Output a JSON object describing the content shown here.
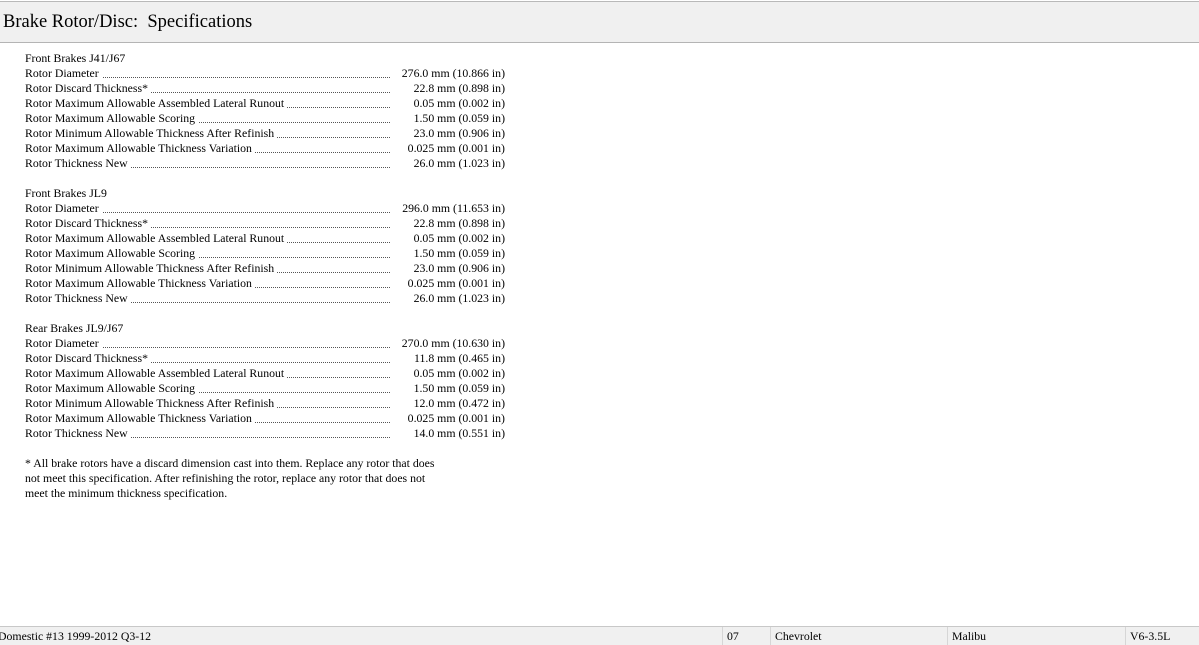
{
  "header": {
    "title": "Brake Rotor/Disc:  Specifications"
  },
  "sections": [
    {
      "heading": "Front Brakes J41/J67",
      "rows": [
        {
          "label": "Rotor Diameter",
          "value": "276.0 mm (10.866 in)"
        },
        {
          "label": "Rotor Discard Thickness*",
          "value": "22.8 mm (0.898 in)"
        },
        {
          "label": "Rotor Maximum Allowable Assembled Lateral Runout",
          "value": "0.05 mm (0.002 in)"
        },
        {
          "label": "Rotor Maximum Allowable Scoring",
          "value": "1.50 mm (0.059 in)"
        },
        {
          "label": "Rotor Minimum Allowable Thickness After Refinish",
          "value": "23.0 mm (0.906 in)"
        },
        {
          "label": "Rotor Maximum Allowable Thickness Variation",
          "value": "0.025 mm (0.001 in)"
        },
        {
          "label": "Rotor Thickness New",
          "value": "26.0 mm (1.023 in)"
        }
      ]
    },
    {
      "heading": "Front Brakes JL9",
      "rows": [
        {
          "label": "Rotor Diameter",
          "value": "296.0 mm (11.653 in)"
        },
        {
          "label": "Rotor Discard Thickness*",
          "value": "22.8 mm (0.898 in)"
        },
        {
          "label": "Rotor Maximum Allowable Assembled Lateral Runout",
          "value": "0.05 mm (0.002 in)"
        },
        {
          "label": "Rotor Maximum Allowable Scoring",
          "value": "1.50 mm (0.059 in)"
        },
        {
          "label": "Rotor Minimum Allowable Thickness After Refinish",
          "value": "23.0 mm (0.906 in)"
        },
        {
          "label": "Rotor Maximum Allowable Thickness Variation",
          "value": "0.025 mm (0.001 in)"
        },
        {
          "label": "Rotor Thickness New",
          "value": "26.0 mm (1.023 in)"
        }
      ]
    },
    {
      "heading": "Rear Brakes JL9/J67",
      "rows": [
        {
          "label": "Rotor Diameter",
          "value": "270.0 mm (10.630 in)"
        },
        {
          "label": "Rotor Discard Thickness*",
          "value": "11.8 mm (0.465 in)"
        },
        {
          "label": "Rotor Maximum Allowable Assembled Lateral Runout",
          "value": "0.05 mm (0.002 in)"
        },
        {
          "label": "Rotor Maximum Allowable Scoring",
          "value": "1.50 mm (0.059 in)"
        },
        {
          "label": "Rotor Minimum Allowable Thickness After Refinish",
          "value": "12.0 mm (0.472 in)"
        },
        {
          "label": "Rotor Maximum Allowable Thickness Variation",
          "value": "0.025 mm (0.001 in)"
        },
        {
          "label": "Rotor Thickness New",
          "value": "14.0 mm (0.551 in)"
        }
      ]
    }
  ],
  "footnote": {
    "lines": [
      "* All brake rotors have a discard dimension cast into them. Replace any rotor that does",
      "not meet this specification. After refinishing the rotor, replace any rotor that does not",
      "meet the minimum thickness specification."
    ]
  },
  "status_bar": {
    "database": "Domestic #13 1999-2012 Q3-12",
    "year": "07",
    "make": "Chevrolet",
    "model": "Malibu",
    "engine": "V6-3.5L"
  }
}
